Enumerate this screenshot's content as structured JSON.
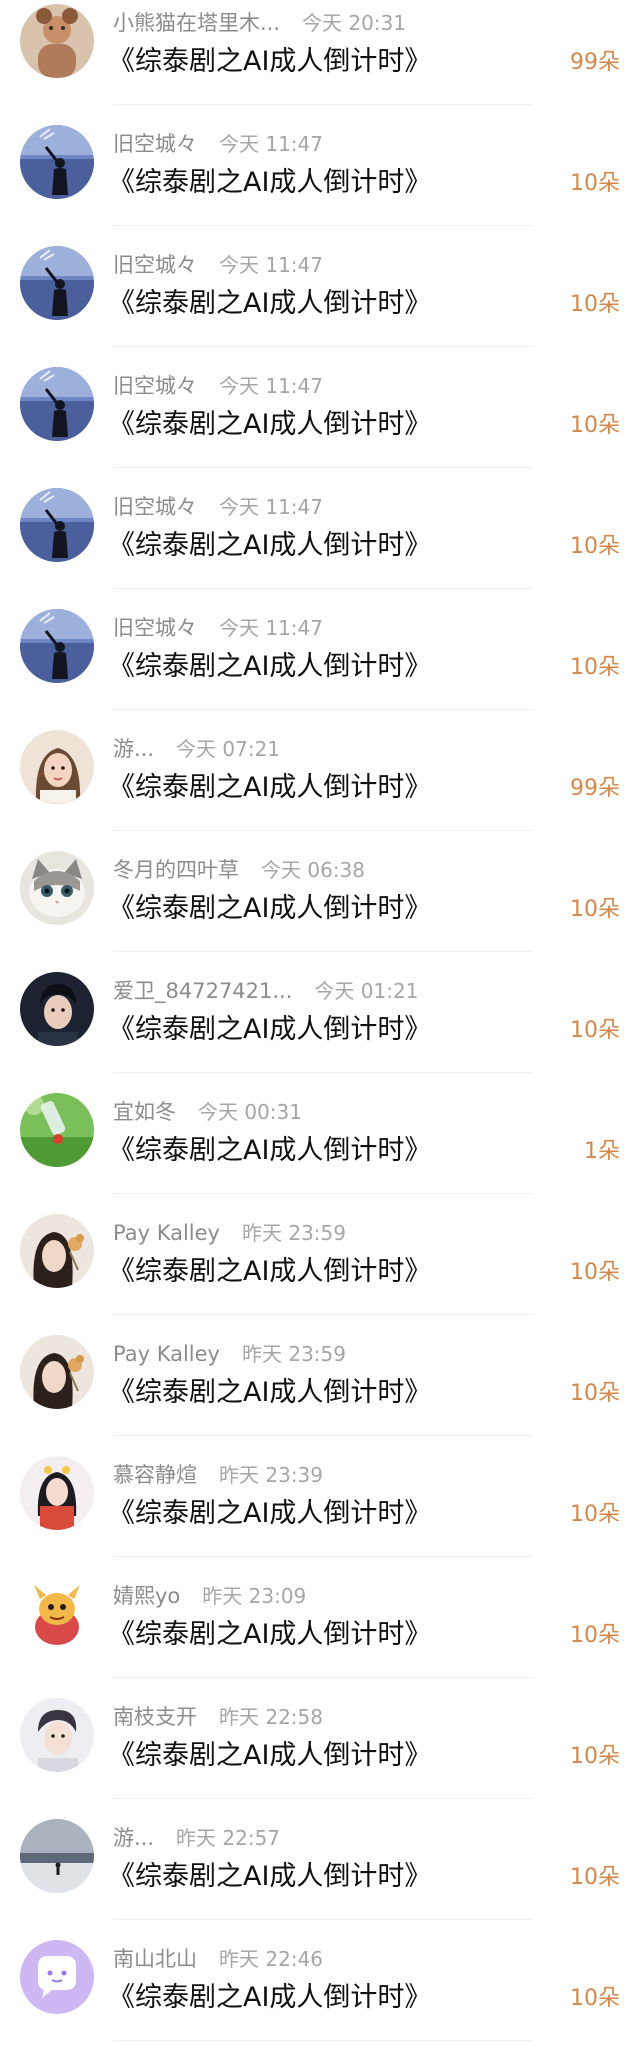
{
  "colors": {
    "name": "#8c8c8c",
    "time": "#a6a6a6",
    "title": "#111111",
    "flowers": "#d4874a",
    "divider": "#efefef"
  },
  "entries": [
    {
      "user": "小熊猫在塔里木...",
      "time": "今天 20:31",
      "title": "《综泰剧之AI成人倒计时》",
      "flowers": "99朵",
      "avatar": "child-photo-avatar"
    },
    {
      "user": "旧空城々",
      "time": "今天 11:47",
      "title": "《综泰剧之AI成人倒计时》",
      "flowers": "10朵",
      "avatar": "silhouette-lake-avatar"
    },
    {
      "user": "旧空城々",
      "time": "今天 11:47",
      "title": "《综泰剧之AI成人倒计时》",
      "flowers": "10朵",
      "avatar": "silhouette-lake-avatar"
    },
    {
      "user": "旧空城々",
      "time": "今天 11:47",
      "title": "《综泰剧之AI成人倒计时》",
      "flowers": "10朵",
      "avatar": "silhouette-lake-avatar"
    },
    {
      "user": "旧空城々",
      "time": "今天 11:47",
      "title": "《综泰剧之AI成人倒计时》",
      "flowers": "10朵",
      "avatar": "silhouette-lake-avatar"
    },
    {
      "user": "旧空城々",
      "time": "今天 11:47",
      "title": "《综泰剧之AI成人倒计时》",
      "flowers": "10朵",
      "avatar": "silhouette-lake-avatar"
    },
    {
      "user": "游...",
      "time": "今天 07:21",
      "title": "《综泰剧之AI成人倒计时》",
      "flowers": "99朵",
      "avatar": "girl-portrait-avatar"
    },
    {
      "user": "冬月的四叶草",
      "time": "今天 06:38",
      "title": "《综泰剧之AI成人倒计时》",
      "flowers": "10朵",
      "avatar": "cat-avatar"
    },
    {
      "user": "爱卫_84727421...",
      "time": "今天 01:21",
      "title": "《综泰剧之AI成人倒计时》",
      "flowers": "10朵",
      "avatar": "man-dark-avatar"
    },
    {
      "user": "宜如冬",
      "time": "今天 00:31",
      "title": "《综泰剧之AI成人倒计时》",
      "flowers": "1朵",
      "avatar": "bottle-grass-avatar"
    },
    {
      "user": "Pay Kalley",
      "time": "昨天 23:59",
      "title": "《综泰剧之AI成人倒计时》",
      "flowers": "10朵",
      "avatar": "woman-flower-avatar"
    },
    {
      "user": "Pay Kalley",
      "time": "昨天 23:59",
      "title": "《综泰剧之AI成人倒计时》",
      "flowers": "10朵",
      "avatar": "woman-flower-avatar"
    },
    {
      "user": "慕容静煊",
      "time": "昨天 23:39",
      "title": "《综泰剧之AI成人倒计时》",
      "flowers": "10朵",
      "avatar": "girl-costume-avatar"
    },
    {
      "user": "婧熙yo",
      "time": "昨天 23:09",
      "title": "《综泰剧之AI成人倒计时》",
      "flowers": "10朵",
      "avatar": "cartoon-dragon-avatar"
    },
    {
      "user": "南枝支开",
      "time": "昨天 22:58",
      "title": "《综泰剧之AI成人倒计时》",
      "flowers": "10朵",
      "avatar": "man-light-avatar"
    },
    {
      "user": "游...",
      "time": "昨天 22:57",
      "title": "《综泰剧之AI成人倒计时》",
      "flowers": "10朵",
      "avatar": "beach-silhouette-avatar"
    },
    {
      "user": "南山北山",
      "time": "昨天 22:46",
      "title": "《综泰剧之AI成人倒计时》",
      "flowers": "10朵",
      "avatar": "chat-bubble-avatar"
    }
  ]
}
